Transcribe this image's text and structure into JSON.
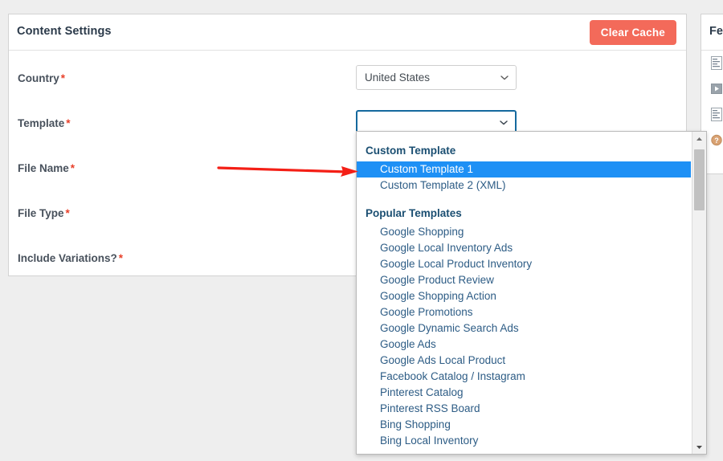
{
  "panel": {
    "title": "Content Settings",
    "clear_cache_label": "Clear Cache",
    "fields": [
      {
        "label": "Country",
        "required": "*",
        "value": "United States"
      },
      {
        "label": "Template",
        "required": "*",
        "value": ""
      },
      {
        "label": "File Name",
        "required": "*"
      },
      {
        "label": "File Type",
        "required": "*"
      },
      {
        "label": "Include Variations?",
        "required": "*"
      }
    ]
  },
  "dropdown": {
    "groups": [
      {
        "label": "Custom Template",
        "items": [
          {
            "label": "Custom Template 1",
            "selected": true
          },
          {
            "label": "Custom Template 2 (XML)",
            "selected": false
          }
        ]
      },
      {
        "label": "Popular Templates",
        "items": [
          {
            "label": "Google Shopping",
            "selected": false
          },
          {
            "label": "Google Local Inventory Ads",
            "selected": false
          },
          {
            "label": "Google Local Product Inventory",
            "selected": false
          },
          {
            "label": "Google Product Review",
            "selected": false
          },
          {
            "label": "Google Shopping Action",
            "selected": false
          },
          {
            "label": "Google Promotions",
            "selected": false
          },
          {
            "label": "Google Dynamic Search Ads",
            "selected": false
          },
          {
            "label": "Google Ads",
            "selected": false
          },
          {
            "label": "Google Ads Local Product",
            "selected": false
          },
          {
            "label": "Facebook Catalog / Instagram",
            "selected": false
          },
          {
            "label": "Pinterest Catalog",
            "selected": false
          },
          {
            "label": "Pinterest RSS Board",
            "selected": false
          },
          {
            "label": "Bing Shopping",
            "selected": false
          },
          {
            "label": "Bing Local Inventory",
            "selected": false
          }
        ]
      }
    ]
  },
  "side_panel": {
    "title": "Fe",
    "items": [
      {
        "icon": "document-list-icon"
      },
      {
        "icon": "video-play-icon"
      },
      {
        "icon": "document-list-icon"
      },
      {
        "icon": "help-circle-icon"
      }
    ]
  },
  "colors": {
    "accent_blue": "#1e90f5",
    "focus_blue": "#15699e",
    "danger_red": "#f36a5a",
    "required_red": "#e8402a",
    "arrow_red": "#f41f16",
    "link_blue": "#2d5c85",
    "header_navy": "#1b4f72"
  }
}
